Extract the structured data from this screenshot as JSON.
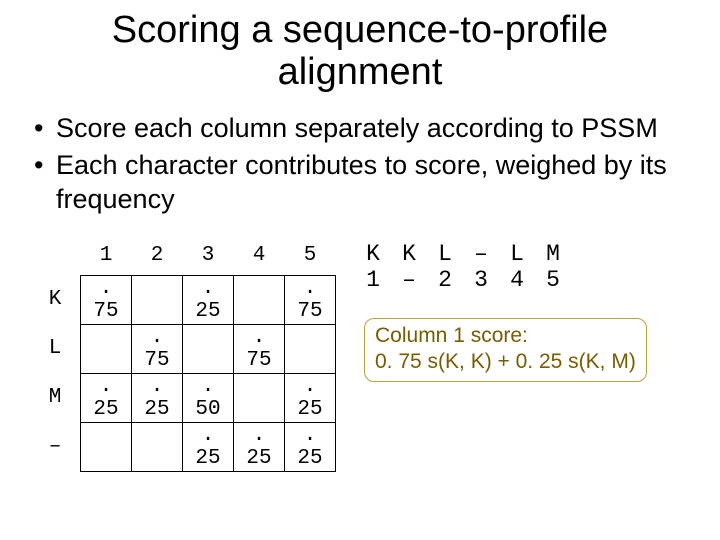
{
  "title_line1": "Scoring a sequence-to-profile",
  "title_line2": "alignment",
  "bullets": [
    "Score each column separately according to PSSM",
    "Each character contributes to score, weighed by its frequency"
  ],
  "pssm": {
    "cols": [
      "1",
      "2",
      "3",
      "4",
      "5"
    ],
    "rows": [
      {
        "label": "K",
        "cells": [
          ". 75",
          "",
          ". 25",
          "",
          ". 75"
        ]
      },
      {
        "label": "L",
        "cells": [
          "",
          ". 75",
          "",
          ". 75",
          ""
        ]
      },
      {
        "label": "M",
        "cells": [
          ". 25",
          ". 25",
          ". 50",
          "",
          ". 25"
        ]
      },
      {
        "label": "–",
        "cells": [
          "",
          "",
          ". 25",
          ". 25",
          ". 25"
        ]
      }
    ]
  },
  "alignment": {
    "row1": [
      "K",
      "K",
      "L",
      "–",
      "L",
      "M"
    ],
    "row2": [
      "1",
      "–",
      "2",
      "3",
      "4",
      "5"
    ]
  },
  "note_line1": "Column 1 score:",
  "note_line2": "0. 75 s(K, K) + 0. 25 s(K, M)"
}
